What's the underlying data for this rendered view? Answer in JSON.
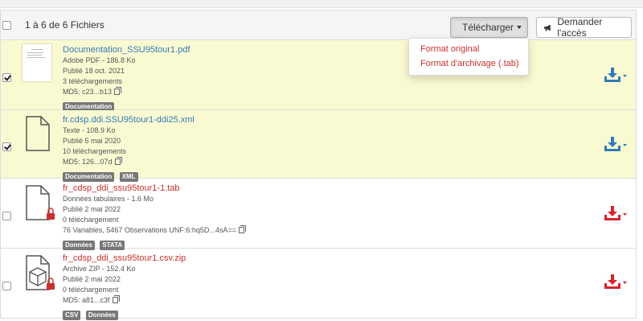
{
  "header": {
    "file_count": "1 à 6 de 6 Fichiers",
    "download_label": "Télécharger",
    "request_access_label": "Demander l'accès"
  },
  "download_menu": {
    "items": [
      "Format original",
      "Format d'archivage (.tab)"
    ]
  },
  "files": [
    {
      "name": "Documentation_SSU95tour1.pdf",
      "type_size": "Adobe PDF - 186.8 Ko",
      "published": "Publié 18 oct. 2021",
      "downloads": "3 téléchargements",
      "checksum": "MD5: c23...b13",
      "tags": [
        "Documentation"
      ],
      "selected": true,
      "restricted": false
    },
    {
      "name": "fr.cdsp.ddi.SSU95tour1-ddi25.xml",
      "type_size": "Texte - 108.9 Ko",
      "published": "Publié 5 mai 2020",
      "downloads": "10 téléchargements",
      "checksum": "MD5: 126...07d",
      "tags": [
        "Documentation",
        "XML"
      ],
      "selected": true,
      "restricted": false
    },
    {
      "name": "fr_cdsp_ddi_ssu95tour1-1.tab",
      "type_size": "Données tabulaires - 1.6 Mo",
      "published": "Publié 2 mai 2022",
      "downloads": "0 téléchargement",
      "checksum": "76 Variables, 5467 Observations UNF:6:hq5D...4sA==",
      "tags": [
        "Données",
        "STATA"
      ],
      "selected": false,
      "restricted": true
    },
    {
      "name": "fr_cdsp_ddi_ssu95tour1.csv.zip",
      "type_size": "Archive ZIP - 152.4 Ko",
      "published": "Publié 2 mai 2022",
      "downloads": "0 téléchargement",
      "checksum": "MD5: a81...c3f",
      "tags": [
        "CSV",
        "Données"
      ],
      "selected": false,
      "restricted": true
    }
  ],
  "colors": {
    "link_blue": "#337ab7",
    "restricted_red": "#c9302c",
    "selected_row": "#fafad2",
    "tag_gray": "#777777"
  },
  "icons": {
    "download_button": "download-icon",
    "request_access_button": "megaphone-icon",
    "file_thumbnail": "file-icon",
    "archive_thumbnail": "box-icon",
    "restricted": "lock-icon",
    "checksum_copy": "copy-icon"
  }
}
